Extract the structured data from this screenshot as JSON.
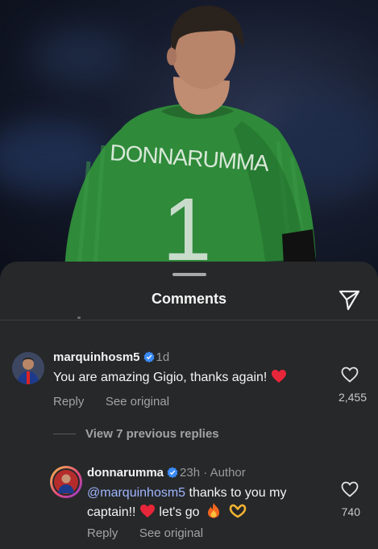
{
  "post": {
    "jersey_name": "DONNARUMMA",
    "jersey_number": "1"
  },
  "sheet": {
    "title": "Comments"
  },
  "comments": [
    {
      "username": "marquinhosm5",
      "verified": true,
      "time": "1d",
      "text": "You are amazing Gigio, thanks again!",
      "emoji": "heart",
      "likes": "2,455",
      "reply_label": "Reply",
      "see_original_label": "See original"
    }
  ],
  "view_replies": "View 7 previous replies",
  "reply": {
    "username": "donnarumma",
    "verified": true,
    "time": "23h",
    "author_label": "Author",
    "mention": "@marquinhosm5",
    "text_part1": " thanks to you my",
    "text_line2": "captain!!",
    "text_part3": " let's go",
    "emojis": [
      "heart",
      "fire",
      "heart-hands"
    ],
    "likes": "740",
    "reply_label": "Reply",
    "see_original_label": "See original"
  },
  "colors": {
    "sheet_bg": "#262829",
    "jersey": "#2f8a3a",
    "heart": "#e8263a",
    "verified": "#3a8bf5",
    "mention": "#9fb5ff"
  }
}
